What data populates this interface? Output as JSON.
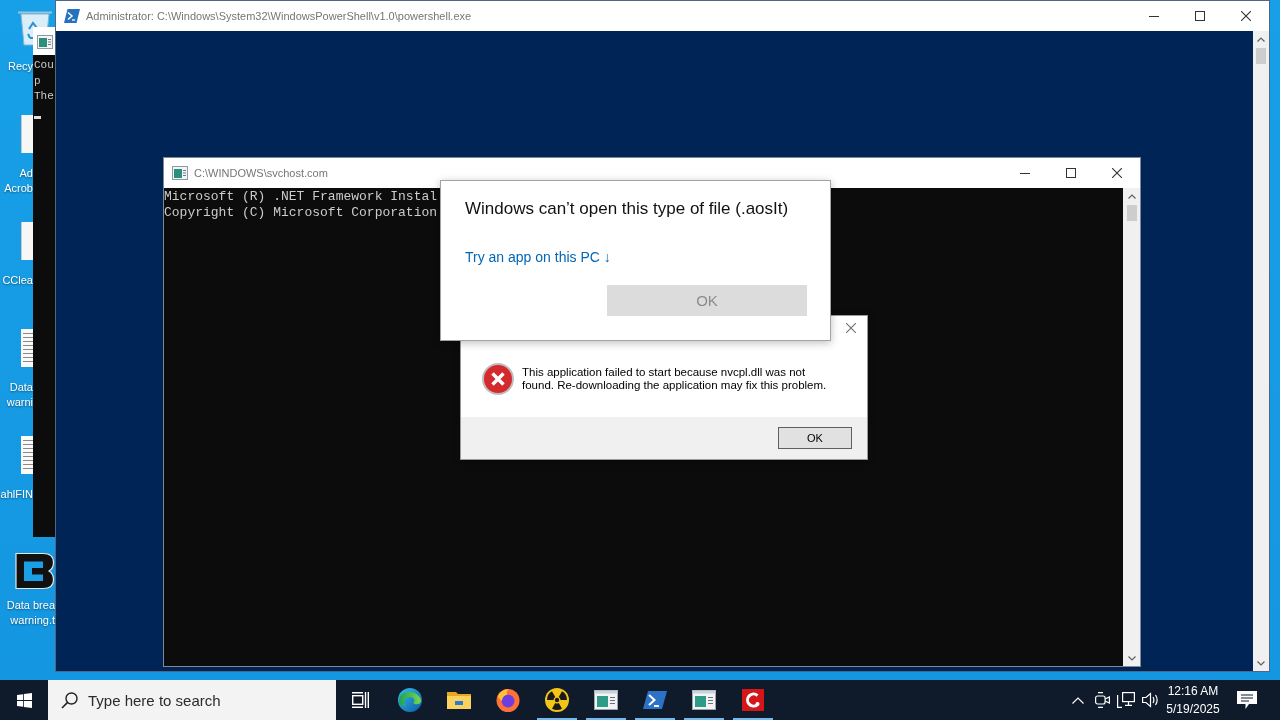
{
  "desktop": {
    "icons": [
      {
        "kind": "recycle-bin",
        "label_lines": [
          "Recy"
        ]
      },
      {
        "kind": "blank-file",
        "label_lines": [
          "Ad",
          "Acrob"
        ]
      },
      {
        "kind": "blank-file",
        "label_lines": [
          "CClea"
        ]
      },
      {
        "kind": "text-file",
        "label_lines": [
          "Data",
          "warni"
        ]
      },
      {
        "kind": "text-file",
        "label_lines": [
          "ahlFIN"
        ]
      },
      {
        "kind": "logo-file",
        "label_lines": [
          "Data brea",
          "warning.t"
        ]
      }
    ]
  },
  "background_console": {
    "lines": [
      "Cou",
      "p",
      "The"
    ]
  },
  "powershell_window": {
    "title": "Administrator: C:\\Windows\\System32\\WindowsPowerShell\\v1.0\\powershell.exe"
  },
  "console_window": {
    "title": "C:\\WINDOWS\\svchost.com",
    "lines": [
      "Microsoft (R) .NET Framework Instal",
      "Copyright (C) Microsoft Corporation"
    ]
  },
  "open_with_dialog": {
    "title": "Windows can’t open this type of file (.aosIt)",
    "link": "Try an app on this PC ↓",
    "ok_button": {
      "label": "OK",
      "disabled": true
    }
  },
  "error_dialog": {
    "message": "This application failed to start because nvcpl.dll was not found. Re-downloading the application may fix this problem.",
    "ok_button": "OK"
  },
  "taskbar": {
    "search": {
      "placeholder": "Type here to search"
    },
    "apps": [
      {
        "kind": "task-view",
        "running": false
      },
      {
        "kind": "edge",
        "running": false
      },
      {
        "kind": "explorer",
        "running": false
      },
      {
        "kind": "firefox",
        "running": false
      },
      {
        "kind": "radiation",
        "running": true
      },
      {
        "kind": "console",
        "running": true
      },
      {
        "kind": "powershell",
        "running": true
      },
      {
        "kind": "console",
        "running": true
      },
      {
        "kind": "red-app",
        "running": true
      }
    ],
    "tray": [
      {
        "kind": "chevron"
      },
      {
        "kind": "camera"
      },
      {
        "kind": "network"
      },
      {
        "kind": "volume"
      }
    ],
    "clock": {
      "time": "12:16 AM",
      "date": "5/19/2025"
    }
  }
}
